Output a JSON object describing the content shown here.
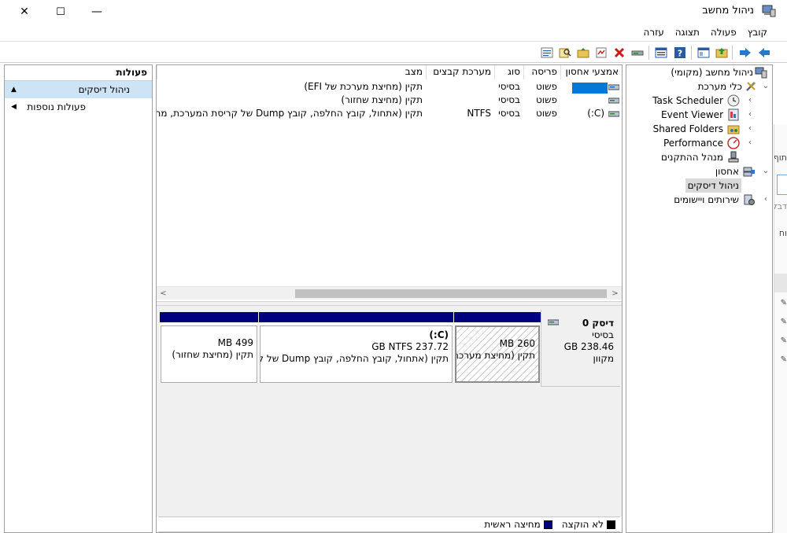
{
  "window": {
    "title": "ניהול מחשב",
    "close_glyph": "✕",
    "maximize_glyph": "☐",
    "minimize_glyph": "—"
  },
  "menu": [
    "קובץ",
    "פעולה",
    "תצוגה",
    "עזרה"
  ],
  "toolbar_icons": [
    "back-arrow-icon",
    "forward-arrow-icon",
    "up-folder-icon",
    "show-tree-icon",
    "help-icon",
    "properties-icon",
    "connect-icon",
    "delete-icon",
    "rescan-icon",
    "folder-icon",
    "search-icon",
    "list-icon"
  ],
  "actions": {
    "header": "פעולות",
    "items": [
      {
        "label": "ניהול דיסקים",
        "arrow": "▲"
      },
      {
        "label": "פעולות נוספות",
        "arrow": "◀"
      }
    ]
  },
  "volumes": {
    "columns": [
      "אמצעי אחסון",
      "פריסה",
      "סוג",
      "מערכת קבצים",
      "מצב"
    ],
    "rows": [
      {
        "volume": "",
        "layout": "פשוט",
        "type": "בסיסי",
        "fs": "",
        "status": "תקין (מחיצת מערכת של EFI)"
      },
      {
        "volume": "",
        "layout": "פשוט",
        "type": "בסיסי",
        "fs": "",
        "status": "תקין (מחיצת שחזור)"
      },
      {
        "volume": "(C:)",
        "layout": "פשוט",
        "type": "בסיסי",
        "fs": "NTFS",
        "status": "תקין (אתחול, קובץ החלפה, קובץ Dump של קריסת המערכת, מחיצה ראשית)"
      }
    ],
    "scroll_left": "<",
    "scroll_right": ">"
  },
  "disk": {
    "name": "דיסק 0",
    "type": "בסיסי",
    "size": "238.46 GB",
    "state": "מקוון",
    "partitions": [
      {
        "title": "",
        "size": "260 MB",
        "status": "תקין (מחיצת מערכת EFI)",
        "hatched": true
      },
      {
        "title": "(C:)",
        "size": "237.72 GB NTFS",
        "status": "תקין (אתחול, קובץ החלפה, קובץ Dump של קריסת המערכת)",
        "hatched": false
      },
      {
        "title": "",
        "size": "499 MB",
        "status": "תקין (מחיצת שחזור)",
        "hatched": false
      }
    ]
  },
  "legend": [
    {
      "label": "לא הוקצה",
      "color": "#000000"
    },
    {
      "label": "מחיצה ראשית",
      "color": "#00007f"
    }
  ],
  "tree": {
    "root": "ניהול מחשב (מקומי)",
    "system_tools": "כלי מערכת",
    "task_scheduler": "Task Scheduler",
    "event_viewer": "Event Viewer",
    "shared_folders": "Shared Folders",
    "performance": "Performance",
    "device_manager": "מנהל ההתקנים",
    "storage": "אחסון",
    "disk_management": "ניהול דיסקים",
    "services": "שירותים ויישומים"
  },
  "background_fragments": [
    "תוף",
    "דבק",
    "וח"
  ],
  "colors": {
    "primary_partition": "#00007f",
    "selection": "#cde4f7",
    "graph_bg": "#f0f0f0"
  }
}
